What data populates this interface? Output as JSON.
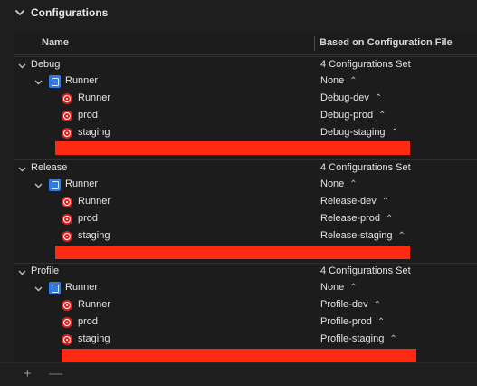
{
  "section": {
    "title": "Configurations"
  },
  "columns": {
    "name": "Name",
    "based_on": "Based on Configuration File"
  },
  "groups": [
    {
      "name": "Debug",
      "summary": "4 Configurations Set",
      "project": {
        "name": "Runner",
        "value": "None"
      },
      "targets": [
        {
          "name": "Runner",
          "value": "Debug-dev"
        },
        {
          "name": "prod",
          "value": "Debug-prod"
        },
        {
          "name": "staging",
          "value": "Debug-staging"
        }
      ]
    },
    {
      "name": "Release",
      "summary": "4 Configurations Set",
      "project": {
        "name": "Runner",
        "value": "None"
      },
      "targets": [
        {
          "name": "Runner",
          "value": "Release-dev"
        },
        {
          "name": "prod",
          "value": "Release-prod"
        },
        {
          "name": "staging",
          "value": "Release-staging"
        }
      ]
    },
    {
      "name": "Profile",
      "summary": "4 Configurations Set",
      "project": {
        "name": "Runner",
        "value": "None"
      },
      "targets": [
        {
          "name": "Runner",
          "value": "Profile-dev"
        },
        {
          "name": "prod",
          "value": "Profile-prod"
        },
        {
          "name": "staging",
          "value": "Profile-staging"
        }
      ]
    }
  ],
  "footer": {
    "add": "+",
    "remove": "—"
  },
  "colors": {
    "background": "#1e1e1e",
    "redaction": "#ff2a12",
    "target_icon": "#e02020",
    "project_icon": "#2f7ae5"
  }
}
